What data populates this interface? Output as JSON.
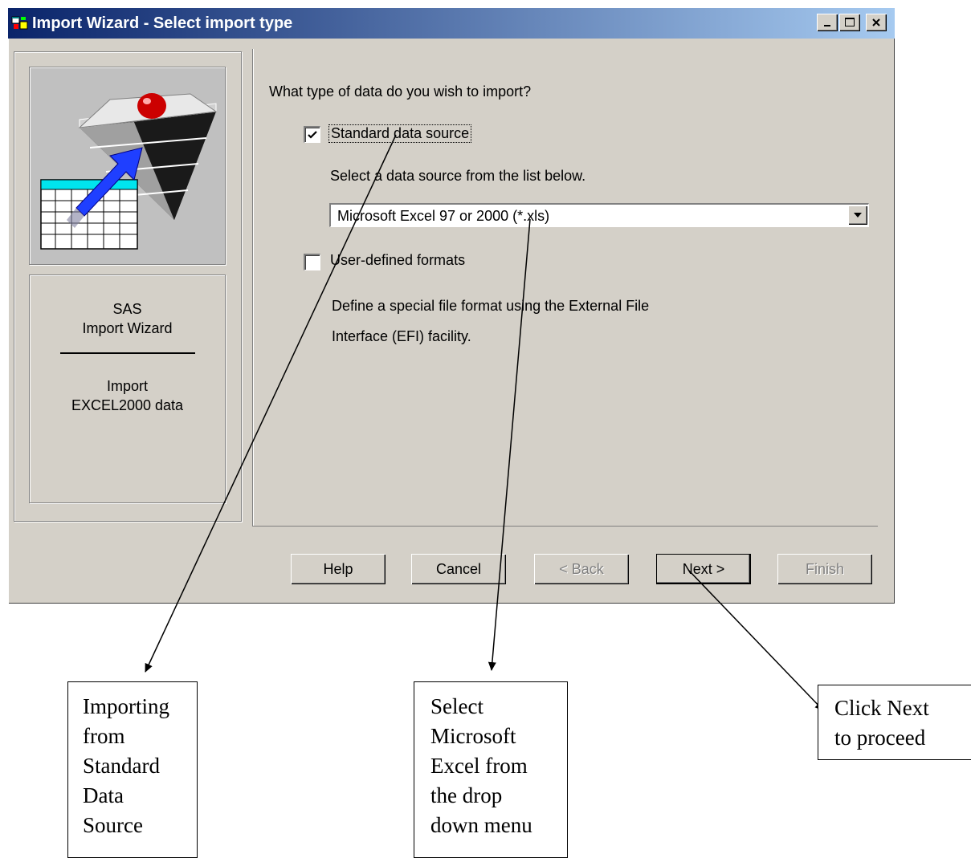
{
  "window": {
    "title": "Import Wizard - Select import type"
  },
  "left_panel": {
    "title": "SAS\nImport Wizard",
    "subtitle": "Import\nEXCEL2000 data"
  },
  "main": {
    "question": "What type of data do you wish to import?",
    "standard_source": {
      "label": "Standard data source",
      "checked": true
    },
    "hint": "Select a data source from the list below.",
    "source_select": {
      "value": "Microsoft Excel 97 or 2000 (*.xls)"
    },
    "user_defined": {
      "label": "User-defined formats",
      "checked": false
    },
    "user_defined_description": "Define a special file format using the External File\nInterface (EFI) facility."
  },
  "buttons": {
    "help": "Help",
    "cancel": "Cancel",
    "back": "< Back",
    "next": "Next >",
    "finish": "Finish"
  },
  "annotations": {
    "standard": "Importing\nfrom\nStandard\nData\nSource",
    "excel": "Select\nMicrosoft\nExcel from\nthe drop\ndown menu",
    "next": "Click Next\nto proceed"
  },
  "colors": {
    "titlebar_start": "#0a246a",
    "titlebar_end": "#a6caf0",
    "dialog_face": "#d4d0c8"
  }
}
